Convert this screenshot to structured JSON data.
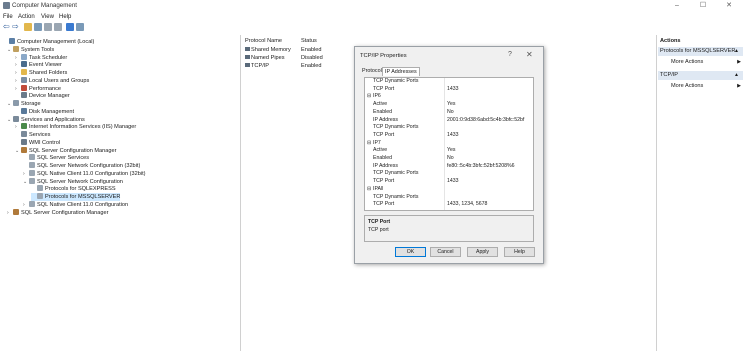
{
  "window": {
    "title": "Computer Management",
    "minimize": "–",
    "maximize": "☐",
    "close": "✕"
  },
  "menu": [
    "File",
    "Action",
    "View",
    "Help"
  ],
  "tree": [
    {
      "label": "Computer Management (Local)",
      "icon": "computer-icon",
      "color": "#5b7fa6",
      "level": 0
    },
    {
      "label": "System Tools",
      "icon": "tools-icon",
      "color": "#c0a060",
      "level": 1,
      "exp": "v"
    },
    {
      "label": "Task Scheduler",
      "icon": "clock-icon",
      "color": "#8aa8c8",
      "level": 2,
      "exp": ">"
    },
    {
      "label": "Event Viewer",
      "icon": "event-viewer-icon",
      "color": "#4a6c8c",
      "level": 2,
      "exp": ">"
    },
    {
      "label": "Shared Folders",
      "icon": "folder-icon",
      "color": "#e2b74c",
      "level": 2,
      "exp": ">"
    },
    {
      "label": "Local Users and Groups",
      "icon": "users-icon",
      "color": "#7a8ea4",
      "level": 2,
      "exp": ">"
    },
    {
      "label": "Performance",
      "icon": "performance-icon",
      "color": "#c04a3a",
      "level": 2,
      "exp": ">"
    },
    {
      "label": "Device Manager",
      "icon": "device-manager-icon",
      "color": "#6a7a8a",
      "level": 2
    },
    {
      "label": "Storage",
      "icon": "storage-icon",
      "color": "#8a9aaa",
      "level": 1,
      "exp": "v"
    },
    {
      "label": "Disk Management",
      "icon": "disk-icon",
      "color": "#5a7a9a",
      "level": 2
    },
    {
      "label": "Services and Applications",
      "icon": "services-icon",
      "color": "#7a8a9a",
      "level": 1,
      "exp": "v"
    },
    {
      "label": "Internet Information Services (IIS) Manager",
      "icon": "iis-icon",
      "color": "#4a8a4a",
      "level": 2,
      "exp": ">"
    },
    {
      "label": "Services",
      "icon": "gear-icon",
      "color": "#7a8a9a",
      "level": 2
    },
    {
      "label": "WMI Control",
      "icon": "wmi-icon",
      "color": "#6a7a8a",
      "level": 2
    },
    {
      "label": "SQL Server Configuration Manager",
      "icon": "sql-config-icon",
      "color": "#b07a3a",
      "level": 2,
      "exp": "v"
    },
    {
      "label": "SQL Server Services",
      "icon": "sql-services-icon",
      "color": "#9aa6b2",
      "level": 3
    },
    {
      "label": "SQL Server Network Configuration (32bit)",
      "icon": "network-icon",
      "color": "#9aa6b2",
      "level": 3
    },
    {
      "label": "SQL Native Client 11.0 Configuration (32bit)",
      "icon": "client-icon",
      "color": "#9aa6b2",
      "level": 3,
      "exp": ">"
    },
    {
      "label": "SQL Server Network Configuration",
      "icon": "network-icon",
      "color": "#9aa6b2",
      "level": 3,
      "exp": "v"
    },
    {
      "label": "Protocols for SQLEXPRESS",
      "icon": "protocols-icon",
      "color": "#9aa6b2",
      "level": 4
    },
    {
      "label": "Protocols for MSSQLSERVER",
      "icon": "protocols-icon",
      "color": "#9aa6b2",
      "level": 4,
      "selected": true
    },
    {
      "label": "SQL Native Client 11.0 Configuration",
      "icon": "client-icon",
      "color": "#9aa6b2",
      "level": 3,
      "exp": ">"
    },
    {
      "label": "SQL Server Configuration Manager",
      "icon": "sql-config-icon",
      "color": "#b07a3a",
      "level": 1,
      "exp": ">"
    }
  ],
  "list": {
    "headers": {
      "name": "Protocol Name",
      "status": "Status"
    },
    "rows": [
      {
        "name": "Shared Memory",
        "status": "Enabled"
      },
      {
        "name": "Named Pipes",
        "status": "Disabled"
      },
      {
        "name": "TCP/IP",
        "status": "Enabled"
      }
    ]
  },
  "actions": {
    "title": "Actions",
    "sections": [
      {
        "header": "Protocols for MSSQLSERVER",
        "items": [
          "More Actions"
        ]
      },
      {
        "header": "TCP/IP",
        "items": [
          "More Actions"
        ]
      }
    ]
  },
  "dialog": {
    "title": "TCP/IP Properties",
    "help": "?",
    "close": "✕",
    "tabs": [
      "Protocol",
      "IP Addresses"
    ],
    "rows": [
      {
        "t": "p",
        "k": "TCP Dynamic Ports",
        "v": ""
      },
      {
        "t": "p",
        "k": "TCP Port",
        "v": "1433"
      },
      {
        "t": "c",
        "k": "IP6",
        "v": ""
      },
      {
        "t": "p",
        "k": "Active",
        "v": "Yes"
      },
      {
        "t": "p",
        "k": "Enabled",
        "v": "No"
      },
      {
        "t": "p",
        "k": "IP Address",
        "v": "2001:0:9d38:6abd:5c4b:3bfc:52bf"
      },
      {
        "t": "p",
        "k": "TCP Dynamic Ports",
        "v": ""
      },
      {
        "t": "p",
        "k": "TCP Port",
        "v": "1433"
      },
      {
        "t": "c",
        "k": "IP7",
        "v": ""
      },
      {
        "t": "p",
        "k": "Active",
        "v": "Yes"
      },
      {
        "t": "p",
        "k": "Enabled",
        "v": "No"
      },
      {
        "t": "p",
        "k": "IP Address",
        "v": "fe80::5c4b:3bfc:52bf:5208%6"
      },
      {
        "t": "p",
        "k": "TCP Dynamic Ports",
        "v": ""
      },
      {
        "t": "p",
        "k": "TCP Port",
        "v": "1433"
      },
      {
        "t": "c",
        "k": "IPAll",
        "v": ""
      },
      {
        "t": "p",
        "k": "TCP Dynamic Ports",
        "v": ""
      },
      {
        "t": "p",
        "k": "TCP Port",
        "v": "1433, 1234, 5678"
      }
    ],
    "description": {
      "title": "TCP Port",
      "text": "TCP port"
    },
    "buttons": {
      "ok": "OK",
      "cancel": "Cancel",
      "apply": "Apply",
      "help": "Help"
    }
  }
}
